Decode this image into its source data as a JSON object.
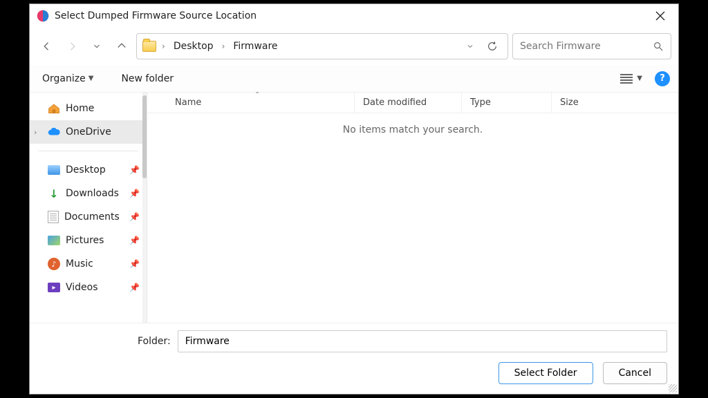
{
  "title": "Select Dumped Firmware Source Location",
  "breadcrumb": {
    "items": [
      "Desktop",
      "Firmware"
    ]
  },
  "search": {
    "placeholder": "Search Firmware"
  },
  "toolbar": {
    "organize": "Organize",
    "newfolder": "New folder"
  },
  "sidebar": {
    "home": "Home",
    "onedrive": "OneDrive",
    "quick": [
      {
        "label": "Desktop"
      },
      {
        "label": "Downloads"
      },
      {
        "label": "Documents"
      },
      {
        "label": "Pictures"
      },
      {
        "label": "Music"
      },
      {
        "label": "Videos"
      }
    ]
  },
  "columns": {
    "name": "Name",
    "date": "Date modified",
    "type": "Type",
    "size": "Size"
  },
  "empty_msg": "No items match your search.",
  "footer": {
    "folder_label": "Folder:",
    "folder_value": "Firmware",
    "select": "Select Folder",
    "cancel": "Cancel"
  }
}
